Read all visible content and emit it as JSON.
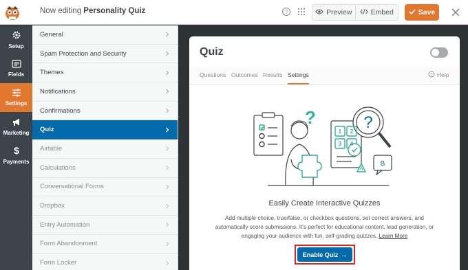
{
  "header": {
    "editing_prefix": "Now editing",
    "form_name": "Personality Quiz",
    "preview_label": "Preview",
    "embed_label": "Embed",
    "save_label": "Save"
  },
  "left_nav": [
    {
      "label": "Setup",
      "icon": "gear-icon"
    },
    {
      "label": "Fields",
      "icon": "fields-icon"
    },
    {
      "label": "Settings",
      "icon": "sliders-icon",
      "active": true
    },
    {
      "label": "Marketing",
      "icon": "megaphone-icon"
    },
    {
      "label": "Payments",
      "icon": "dollar-icon"
    }
  ],
  "settings_panel": {
    "items": [
      {
        "label": "General"
      },
      {
        "label": "Spam Protection and Security"
      },
      {
        "label": "Themes"
      },
      {
        "label": "Notifications"
      },
      {
        "label": "Confirmations"
      },
      {
        "label": "Quiz",
        "active": true
      },
      {
        "label": "Airtable",
        "muted": true
      },
      {
        "label": "Calculations",
        "muted": true
      },
      {
        "label": "Conversational Forms",
        "muted": true
      },
      {
        "label": "Dropbox",
        "muted": true
      },
      {
        "label": "Entry Automation",
        "muted": true
      },
      {
        "label": "Form Abandonment",
        "muted": true
      },
      {
        "label": "Form Locker",
        "muted": true
      }
    ]
  },
  "quiz_card": {
    "title": "Quiz",
    "tabs": [
      {
        "label": "Questions"
      },
      {
        "label": "Outcomes"
      },
      {
        "label": "Results"
      },
      {
        "label": "Settings",
        "active": true
      }
    ],
    "help_label": "Help",
    "heading": "Easily Create Interactive Quizzes",
    "description": "Add multiple choice, true/false, or checkbox questions, set correct answers, and automatically score submissions. It's perfect for educational content, lead generation, or engaging your audience with fun, self-grading quizzes.",
    "learn_more": "Learn More",
    "enable_label": "Enable Quiz",
    "enable_arrow": "→",
    "illustration": {
      "question_mark": "?",
      "grid_numbers": [
        "1",
        "2",
        "3",
        "4"
      ],
      "bubble_letters": [
        "A",
        "B"
      ]
    }
  },
  "colors": {
    "accent_orange": "#e27730",
    "primary_blue": "#036aab",
    "nav_dark": "#3c434a",
    "highlight_red": "#e1251b",
    "teal": "#2cb39a"
  }
}
